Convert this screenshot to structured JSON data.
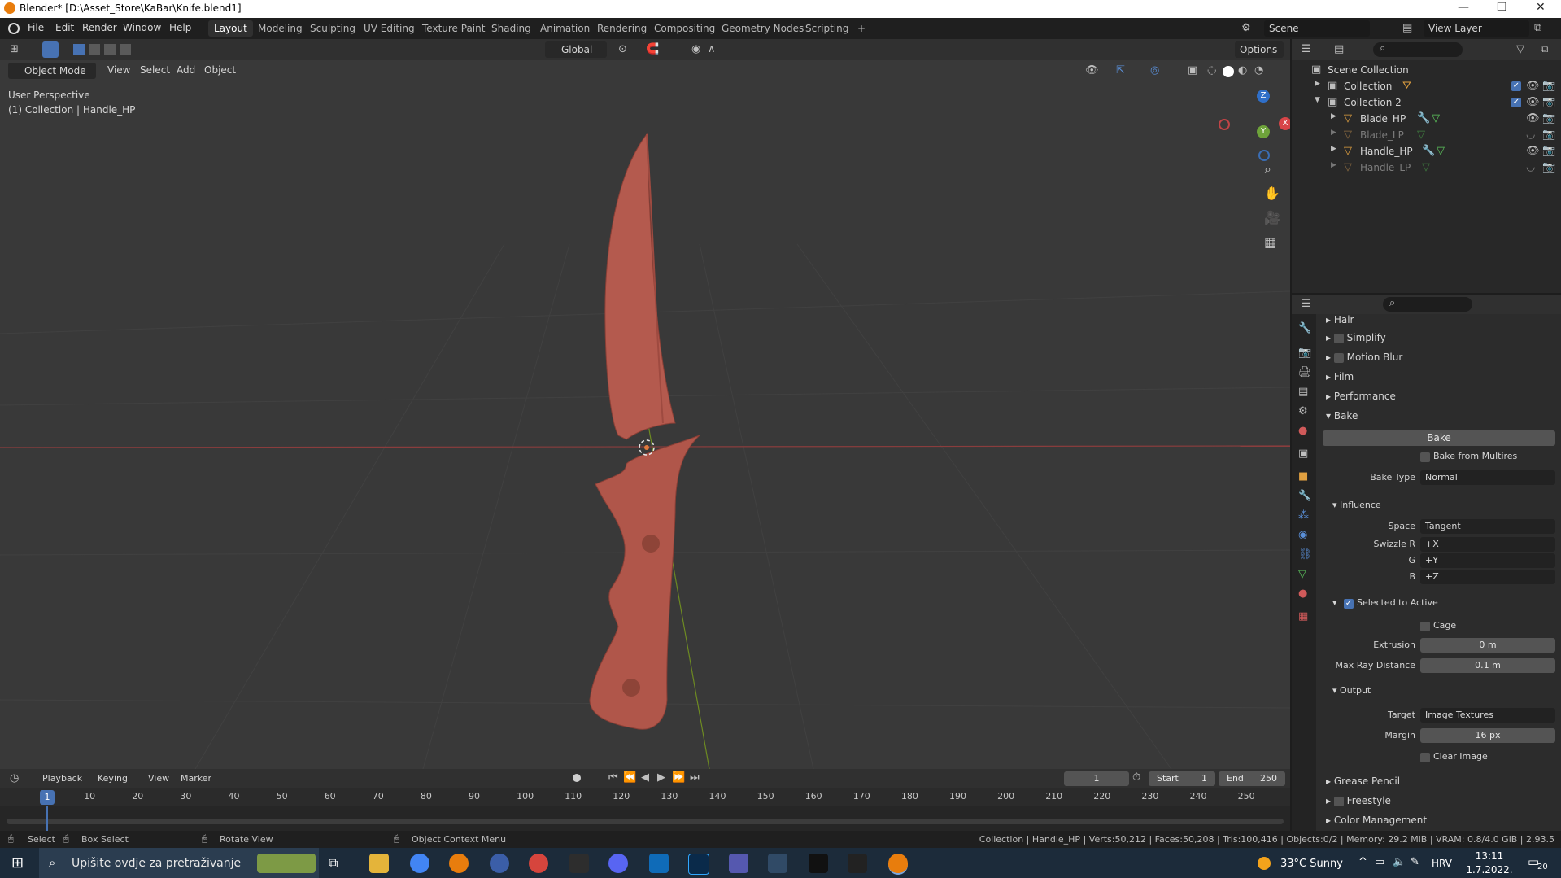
{
  "window": {
    "title": "Blender* [D:\\Asset_Store\\KaBar\\Knife.blend1]"
  },
  "menu": {
    "items": [
      "File",
      "Edit",
      "Render",
      "Window",
      "Help"
    ]
  },
  "workspaces": {
    "tabs": [
      "Layout",
      "Modeling",
      "Sculpting",
      "UV Editing",
      "Texture Paint",
      "Shading",
      "Animation",
      "Rendering",
      "Compositing",
      "Geometry Nodes",
      "Scripting"
    ],
    "active": "Layout",
    "add": "+"
  },
  "scene": {
    "name": "Scene",
    "view_layer": "View Layer"
  },
  "viewport": {
    "transform_orientation": "Global",
    "options_label": "Options",
    "mode": "Object Mode",
    "menus": [
      "View",
      "Select",
      "Add",
      "Object"
    ],
    "overlay_title": "User Perspective",
    "overlay_subtitle": "(1) Collection | Handle_HP",
    "gizmo": {
      "x": "X",
      "y": "Y",
      "z": "Z"
    },
    "colors": {
      "knife": "#b85a4e",
      "x_axis": "#a3423f",
      "y_axis": "#7b9b2c",
      "background": "#393939"
    }
  },
  "outliner": {
    "root": "Scene Collection",
    "items": [
      {
        "name": "Collection",
        "level": 1,
        "faded": false
      },
      {
        "name": "Collection 2",
        "level": 1,
        "faded": false
      },
      {
        "name": "Blade_HP",
        "level": 2,
        "faded": false
      },
      {
        "name": "Blade_LP",
        "level": 2,
        "faded": true
      },
      {
        "name": "Handle_HP",
        "level": 2,
        "faded": false
      },
      {
        "name": "Handle_LP",
        "level": 2,
        "faded": true
      }
    ]
  },
  "properties": {
    "panels_top": [
      "Hair",
      "Simplify",
      "Motion Blur",
      "Film",
      "Performance",
      "Bake"
    ],
    "bake_button": "Bake",
    "bake_from_multires": "Bake from Multires",
    "bake_type_label": "Bake Type",
    "bake_type": "Normal",
    "influence": "Influence",
    "space_label": "Space",
    "space": "Tangent",
    "swizzle_r_label": "Swizzle R",
    "swizzle_r": "+X",
    "g_label": "G",
    "swizzle_g": "+Y",
    "b_label": "B",
    "swizzle_b": "+Z",
    "selected_to_active": "Selected to Active",
    "cage": "Cage",
    "extrusion_label": "Extrusion",
    "extrusion": "0 m",
    "max_ray_label": "Max Ray Distance",
    "max_ray": "0.1 m",
    "output": "Output",
    "target_label": "Target",
    "target": "Image Textures",
    "margin_label": "Margin",
    "margin": "16 px",
    "clear_image": "Clear Image",
    "panels_bottom": [
      "Grease Pencil",
      "Freestyle",
      "Color Management"
    ]
  },
  "timeline": {
    "menus": [
      "Playback",
      "Keying",
      "View",
      "Marker"
    ],
    "current_frame": "1",
    "start_label": "Start",
    "start": "1",
    "end_label": "End",
    "end": "250",
    "ruler": [
      "10",
      "20",
      "30",
      "40",
      "50",
      "60",
      "70",
      "80",
      "90",
      "100",
      "110",
      "120",
      "130",
      "140",
      "150",
      "160",
      "170",
      "180",
      "190",
      "200",
      "210",
      "220",
      "230",
      "240",
      "250"
    ],
    "playhead": "1"
  },
  "statusbar": {
    "select": "Select",
    "box_select": "Box Select",
    "rotate_view": "Rotate View",
    "context_menu": "Object Context Menu",
    "stats": "Collection | Handle_HP | Verts:50,212 | Faces:50,208 | Tris:100,416 | Objects:0/2 | Memory: 29.2 MiB | VRAM: 0.8/4.0 GiB | 2.93.5"
  },
  "taskbar": {
    "search_placeholder": "Upišite ovdje za pretraživanje",
    "weather": "33°C  Sunny",
    "language": "HRV",
    "time": "13:11",
    "date": "1.7.2022.",
    "notifications": "20"
  }
}
